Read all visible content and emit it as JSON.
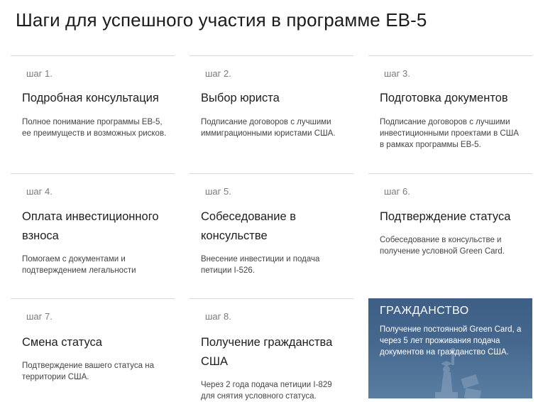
{
  "page": {
    "title": "Шаги для успешного участия в программе ЕВ-5"
  },
  "steps": [
    {
      "num": "шаг 1.",
      "title": "Подробная консультация",
      "desc": "Полное понимание программы ЕВ-5, ее преимуществ и возможных рисков."
    },
    {
      "num": "шаг 2.",
      "title": "Выбор юриста",
      "desc": "Подписание договоров с лучшими иммиграционными юристами США."
    },
    {
      "num": "шаг 3.",
      "title": "Подготовка документов",
      "desc": "Подписание договоров с лучшими инвестиционными проектами в США в рамках программы ЕВ-5."
    },
    {
      "num": "шаг 4.",
      "title": "Оплата инвестиционного взноса",
      "desc": "Помогаем с документами и подтверждением легальности"
    },
    {
      "num": "шаг 5.",
      "title": "Собеседование в консульстве",
      "desc": "Внесение инвестиции и подача петиции I-526."
    },
    {
      "num": "шаг 6.",
      "title": "Подтверждение статуса",
      "desc": "Собеседование в консульстве и получение условной Green Card."
    },
    {
      "num": "шаг 7.",
      "title": "Смена статуса",
      "desc": "Подтверждение вашего статуса на территории США."
    },
    {
      "num": "шаг 8.",
      "title": "Получение гражданства США",
      "desc": "Через 2 года подача петиции I-829 для снятия условного статуса."
    }
  ],
  "citizenship": {
    "title": "ГРАЖДАНСТВО",
    "desc": "Получение постоянной Green Card, а через 5 лет проживания подача документов на гражданство США.",
    "icon": "statue-of-liberty-icon"
  },
  "colors": {
    "card_border": "#d9d9cf",
    "citizenship_bg": "#46688f"
  }
}
